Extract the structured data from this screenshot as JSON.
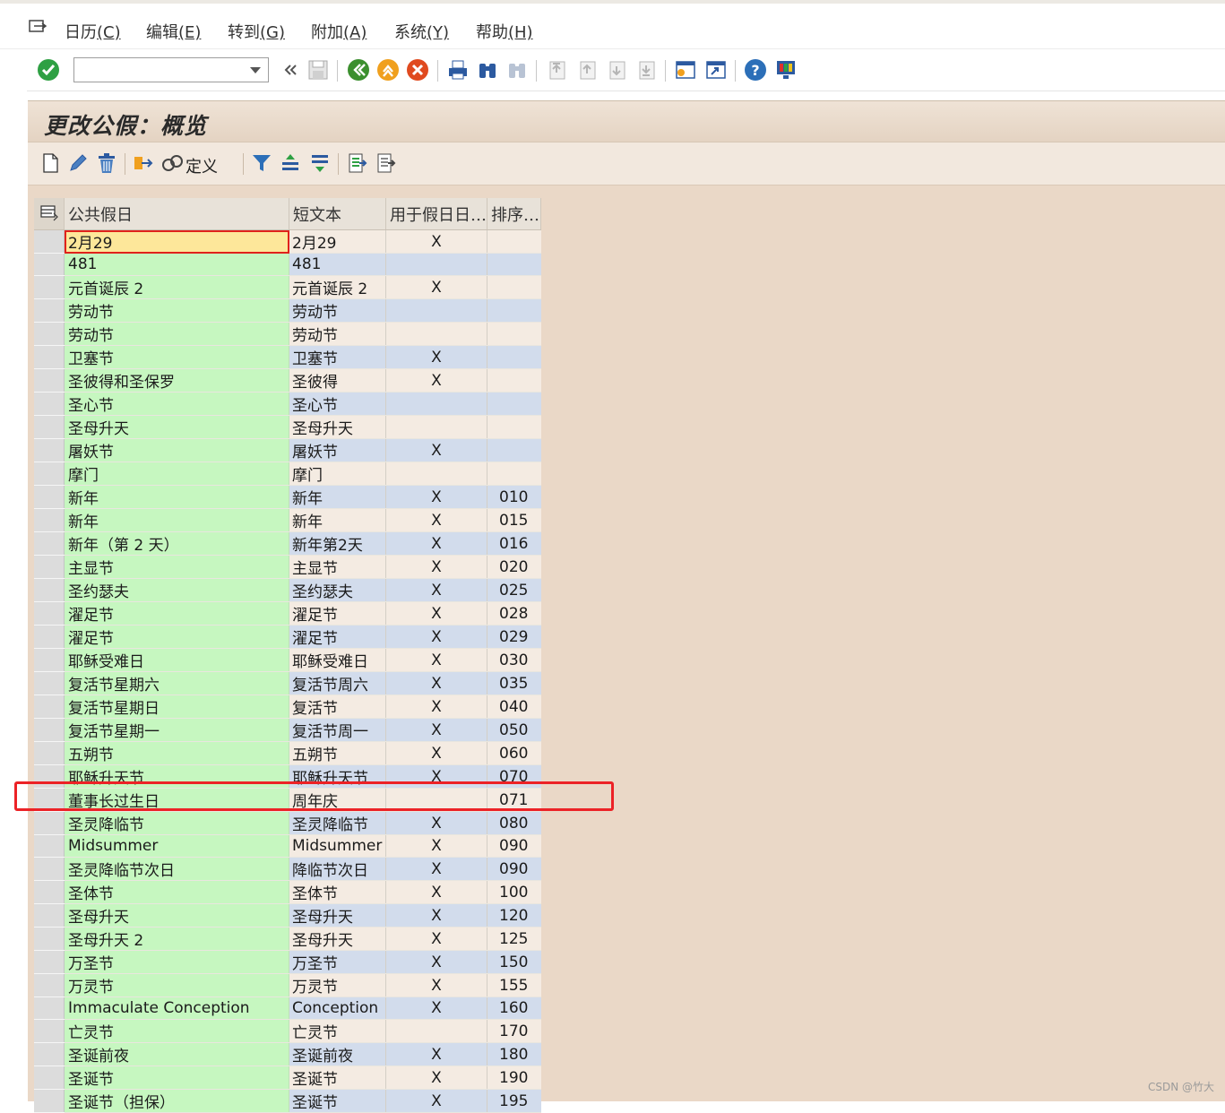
{
  "menubar": {
    "items": [
      {
        "label": "日历",
        "key": "(C)"
      },
      {
        "label": "编辑",
        "key": "(E)"
      },
      {
        "label": "转到",
        "key": "(G)"
      },
      {
        "label": "附加",
        "key": "(A)"
      },
      {
        "label": "系统",
        "key": "(Y)"
      },
      {
        "label": "帮助",
        "key": "(H)"
      }
    ]
  },
  "toolbar": {
    "command_value": "",
    "icons": [
      "enter-icon",
      "command-field",
      "collapse-icon",
      "save-icon",
      "back-icon",
      "exit-icon",
      "cancel-icon",
      "print-icon",
      "find-icon",
      "find-next-icon",
      "first-page-icon",
      "previous-page-icon",
      "next-page-icon",
      "last-page-icon",
      "new-session-icon",
      "shortcut-icon",
      "help-icon",
      "layout-menu-icon"
    ]
  },
  "screen": {
    "title": "更改公假：概览"
  },
  "app_toolbar": {
    "define_label": "定义",
    "icons": [
      "new-entry-icon",
      "change-icon",
      "delete-icon",
      "transport-icon",
      "define-icon",
      "filter-icon",
      "sort-ascending-icon",
      "sort-descending-icon",
      "export-icon",
      "details-icon"
    ]
  },
  "table": {
    "headers": [
      "公共假日",
      "短文本",
      "用于假日日…",
      "排序…"
    ],
    "rows": [
      [
        "2月29",
        "2月29",
        "X",
        ""
      ],
      [
        "481",
        "481",
        "",
        ""
      ],
      [
        "元首诞辰 2",
        "元首诞辰 2",
        "X",
        ""
      ],
      [
        "劳动节",
        "劳动节",
        "",
        ""
      ],
      [
        "劳动节",
        "劳动节",
        "",
        ""
      ],
      [
        "卫塞节",
        "卫塞节",
        "X",
        ""
      ],
      [
        "圣彼得和圣保罗",
        "圣彼得",
        "X",
        ""
      ],
      [
        "圣心节",
        "圣心节",
        "",
        ""
      ],
      [
        "圣母升天",
        "圣母升天",
        "",
        ""
      ],
      [
        "屠妖节",
        "屠妖节",
        "X",
        ""
      ],
      [
        "摩门",
        "摩门",
        "",
        ""
      ],
      [
        "新年",
        "新年",
        "X",
        "010"
      ],
      [
        "新年",
        "新年",
        "X",
        "015"
      ],
      [
        "新年（第 2 天）",
        "新年第2天",
        "X",
        "016"
      ],
      [
        "主显节",
        "主显节",
        "X",
        "020"
      ],
      [
        "圣约瑟夫",
        "圣约瑟夫",
        "X",
        "025"
      ],
      [
        "濯足节",
        "濯足节",
        "X",
        "028"
      ],
      [
        "濯足节",
        "濯足节",
        "X",
        "029"
      ],
      [
        "耶稣受难日",
        "耶稣受难日",
        "X",
        "030"
      ],
      [
        "复活节星期六",
        "复活节周六",
        "X",
        "035"
      ],
      [
        "复活节星期日",
        "复活节",
        "X",
        "040"
      ],
      [
        "复活节星期一",
        "复活节周一",
        "X",
        "050"
      ],
      [
        "五朔节",
        "五朔节",
        "X",
        "060"
      ],
      [
        "耶稣升天节",
        "耶稣升天节",
        "X",
        "070"
      ],
      [
        "董事长过生日",
        "周年庆",
        "",
        "071"
      ],
      [
        "圣灵降临节",
        "圣灵降临节",
        "X",
        "080"
      ],
      [
        "Midsummer",
        "Midsummer",
        "X",
        "090"
      ],
      [
        "圣灵降临节次日",
        "降临节次日",
        "X",
        "090"
      ],
      [
        "圣体节",
        "圣体节",
        "X",
        "100"
      ],
      [
        "圣母升天",
        "圣母升天",
        "X",
        "120"
      ],
      [
        "圣母升天 2",
        "圣母升天",
        "X",
        "125"
      ],
      [
        "万圣节",
        "万圣节",
        "X",
        "150"
      ],
      [
        "万灵节",
        "万灵节",
        "X",
        "155"
      ],
      [
        "Immaculate Conception",
        "Conception",
        "X",
        "160"
      ],
      [
        "亡灵节",
        "亡灵节",
        "",
        "170"
      ],
      [
        "圣诞前夜",
        "圣诞前夜",
        "X",
        "180"
      ],
      [
        "圣诞节",
        "圣诞节",
        "X",
        "190"
      ],
      [
        "圣诞节（担保）",
        "圣诞节",
        "X",
        "195"
      ]
    ]
  },
  "watermark": "CSDN @竹大"
}
